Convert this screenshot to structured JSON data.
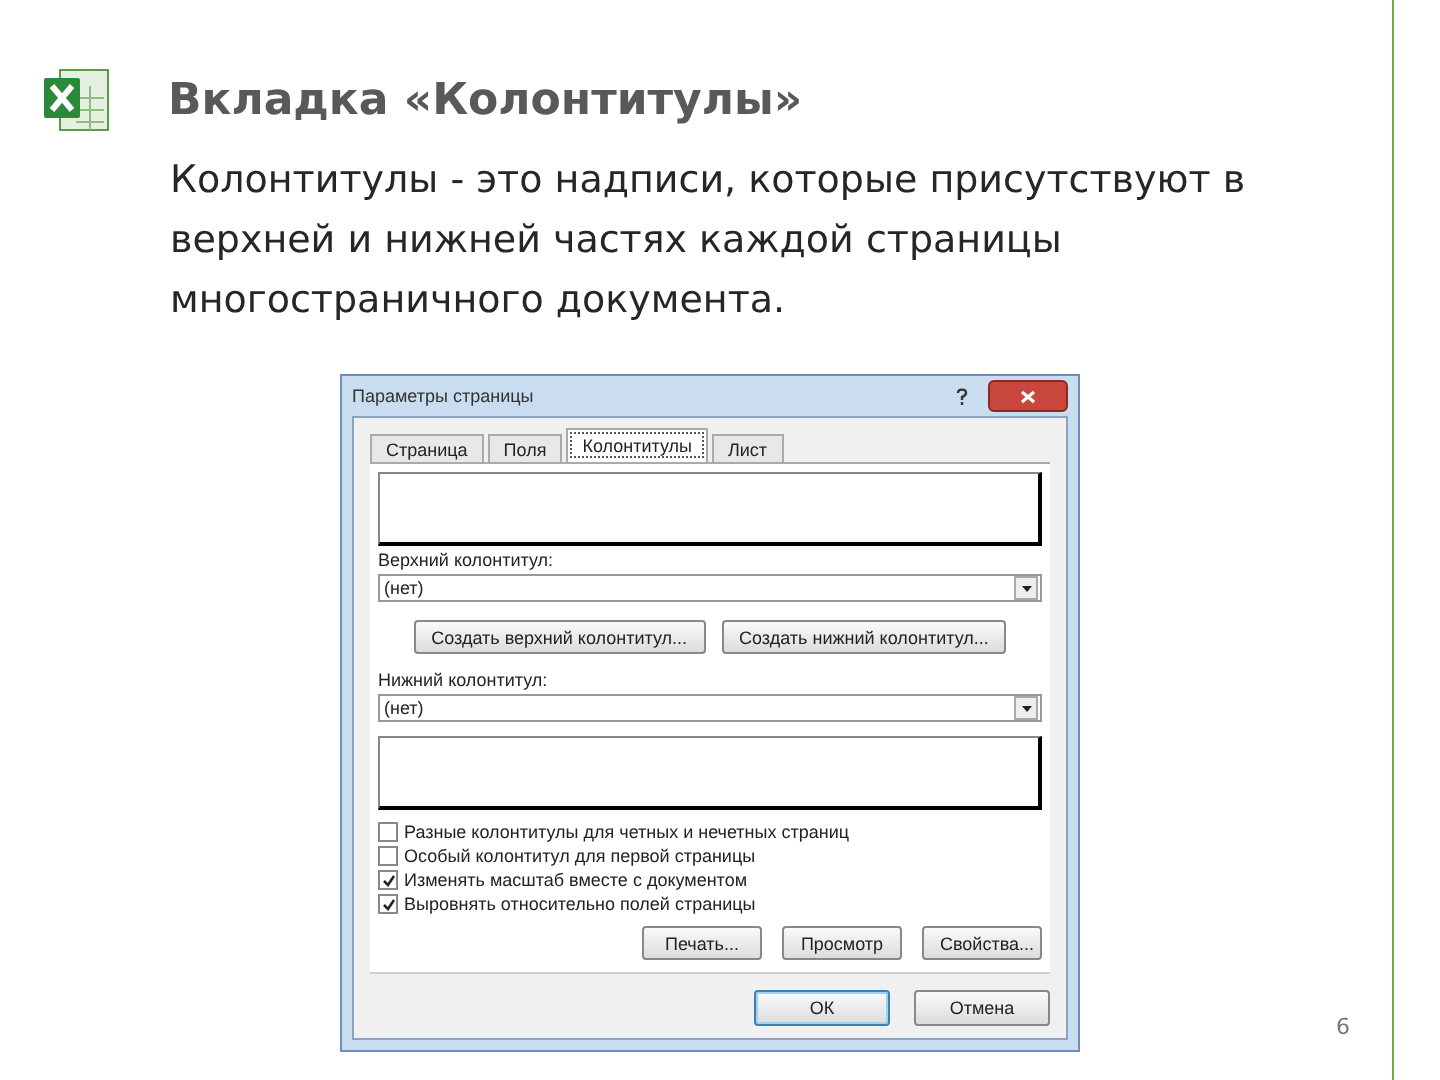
{
  "slide": {
    "title": "Вкладка «Колонтитулы»",
    "body": "Колонтитулы - это надписи, которые присутствуют в верхней и нижней частях каждой страницы многостраничного документа.",
    "page_number": "6"
  },
  "dialog": {
    "title": "Параметры страницы",
    "tabs": [
      {
        "label": "Страница",
        "selected": false
      },
      {
        "label": "Поля",
        "selected": false
      },
      {
        "label": "Колонтитулы",
        "selected": true
      },
      {
        "label": "Лист",
        "selected": false
      }
    ],
    "header_label": "Верхний колонтитул:",
    "header_value": "(нет)",
    "create_buttons": [
      "Создать верхний колонтитул...",
      "Создать нижний колонтитул..."
    ],
    "footer_label": "Нижний колонтитул:",
    "footer_value": "(нет)",
    "checkboxes": [
      {
        "label": "Разные колонтитулы для четных и нечетных страниц",
        "checked": false
      },
      {
        "label": "Особый колонтитул для первой страницы",
        "checked": false
      },
      {
        "label": "Изменять масштаб вместе с документом",
        "checked": true
      },
      {
        "label": "Выровнять относительно полей страницы",
        "checked": true
      }
    ],
    "action_buttons": [
      "Печать...",
      "Просмотр",
      "Свойства..."
    ],
    "footer_buttons": [
      {
        "label": "ОК",
        "default": true
      },
      {
        "label": "Отмена",
        "default": false
      }
    ]
  }
}
